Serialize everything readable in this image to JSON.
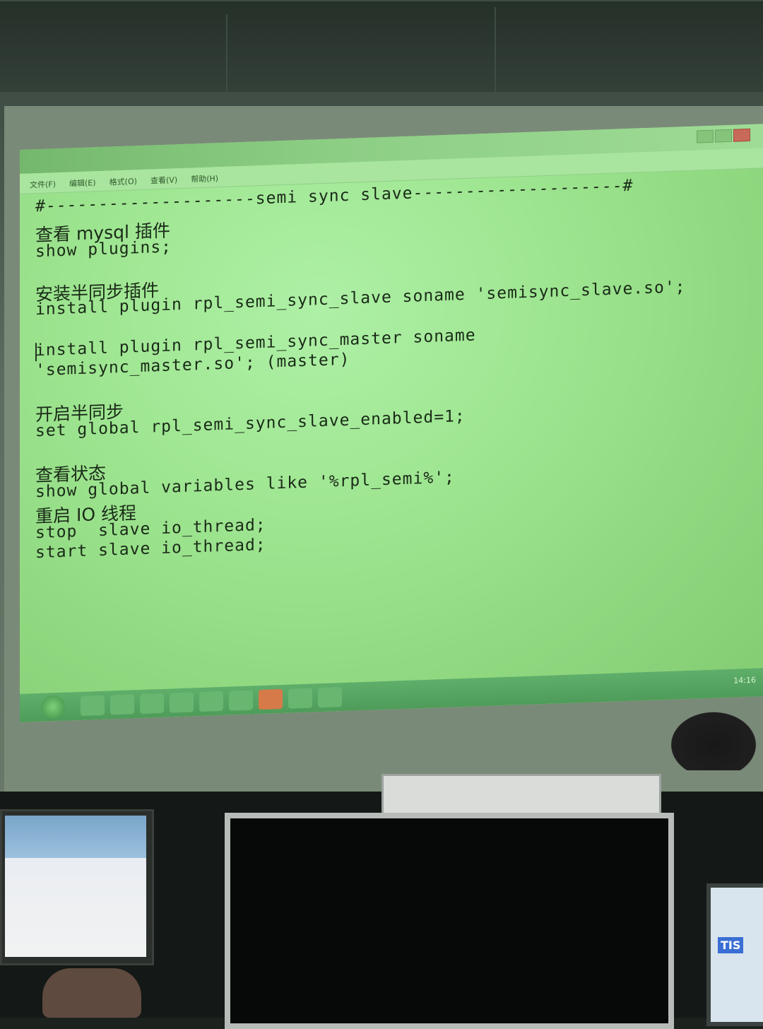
{
  "window": {
    "title": "",
    "menu": [
      "文件(F)",
      "编辑(E)",
      "格式(O)",
      "查看(V)",
      "帮助(H)"
    ]
  },
  "editor": {
    "lines": [
      "#--------------------semi sync slave--------------------#",
      "查看 mysql 插件",
      "show plugins;",
      "",
      "安装半同步插件",
      "install plugin rpl_semi_sync_slave soname 'semisync_slave.so';",
      "",
      "install plugin rpl_semi_sync_master soname",
      "'semisync_master.so'; (master)",
      "",
      "开启半同步",
      "set global rpl_semi_sync_slave_enabled=1;",
      "",
      "查看状态",
      "show global variables like '%rpl_semi%';",
      "重启 IO 线程",
      "stop  slave io_thread;",
      "start slave io_thread;"
    ]
  },
  "taskbar": {
    "clock": "14:16"
  },
  "desk": {
    "right_monitor_label": "TIS"
  }
}
